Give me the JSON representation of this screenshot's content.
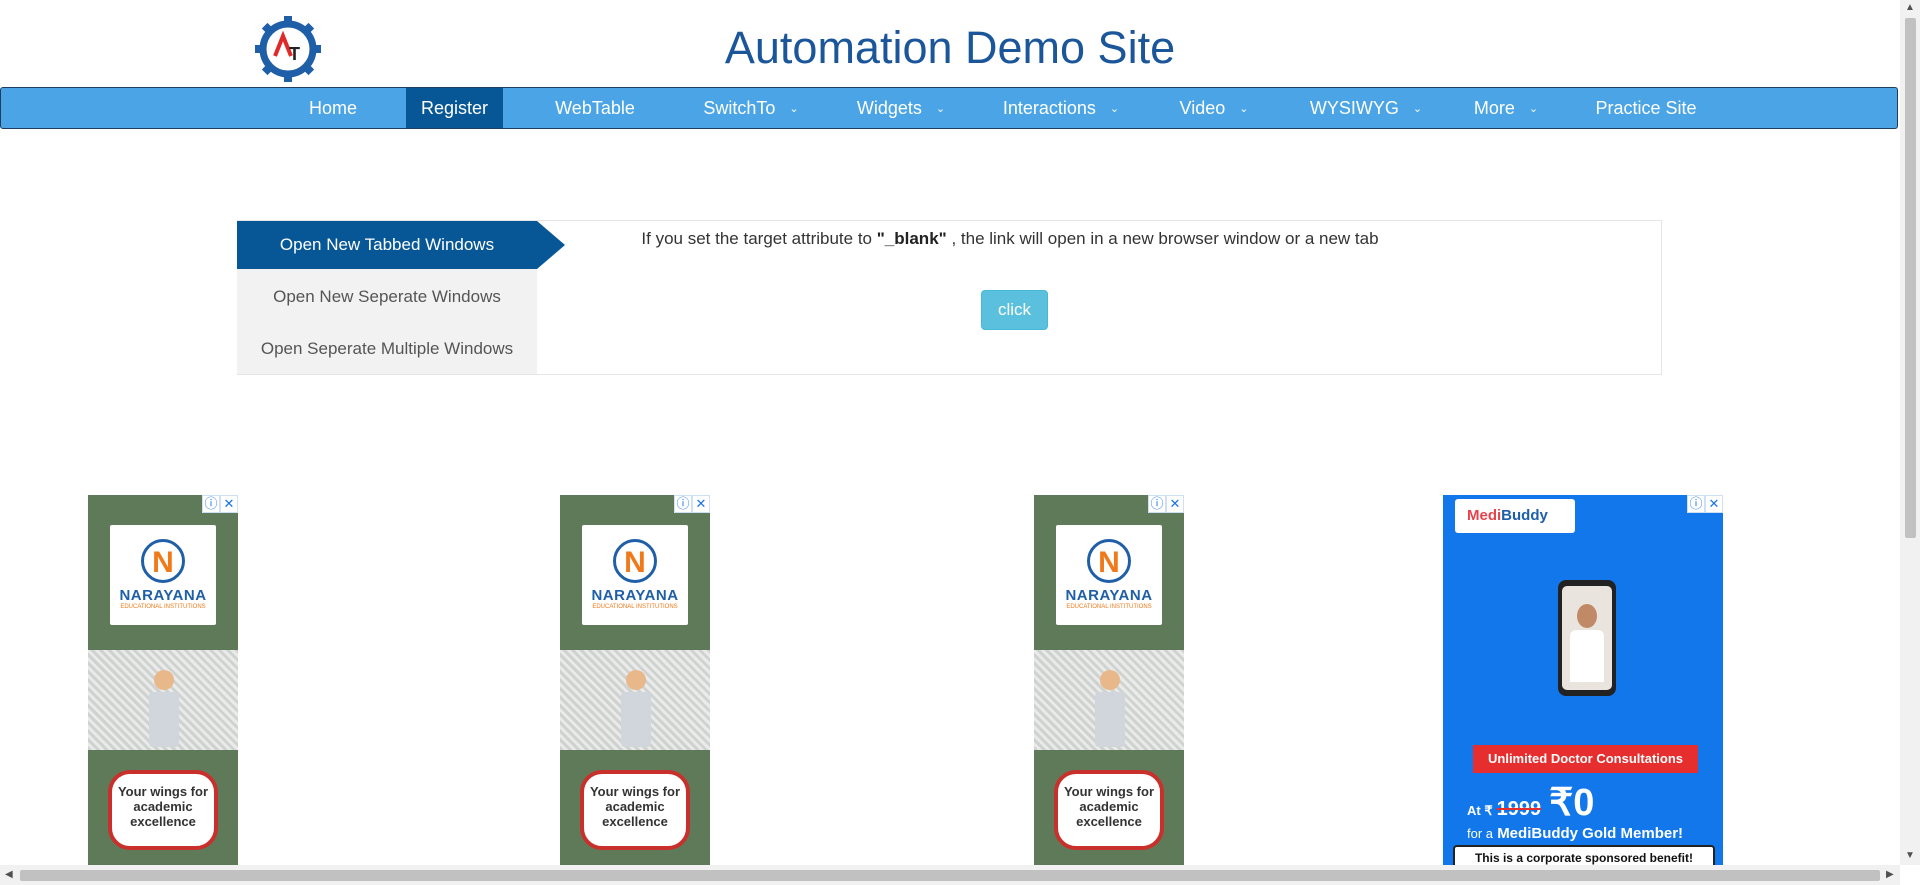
{
  "header": {
    "title": "Automation Demo Site",
    "logo_letters": "AT"
  },
  "nav": {
    "items": [
      {
        "label": "Home",
        "has_dropdown": false,
        "active": false
      },
      {
        "label": "Register",
        "has_dropdown": false,
        "active": true
      },
      {
        "label": "WebTable",
        "has_dropdown": false,
        "active": false
      },
      {
        "label": "SwitchTo",
        "has_dropdown": true,
        "active": false
      },
      {
        "label": "Widgets",
        "has_dropdown": true,
        "active": false
      },
      {
        "label": "Interactions",
        "has_dropdown": true,
        "active": false
      },
      {
        "label": "Video",
        "has_dropdown": true,
        "active": false
      },
      {
        "label": "WYSIWYG",
        "has_dropdown": true,
        "active": false
      },
      {
        "label": "More",
        "has_dropdown": true,
        "active": false
      },
      {
        "label": "Practice Site",
        "has_dropdown": false,
        "active": false
      }
    ],
    "chevron_glyph": "⌄"
  },
  "windows": {
    "tabs": [
      {
        "label": "Open New Tabbed Windows",
        "active": true
      },
      {
        "label": "Open New Seperate Windows",
        "active": false
      },
      {
        "label": "Open Seperate Multiple Windows",
        "active": false
      }
    ],
    "description_pre": "If you set the target attribute to ",
    "description_code": "\"_blank\"",
    "description_post": " , the link will open in a new browser window or a new tab",
    "button_label": "click"
  },
  "ads": {
    "close_info": "ⓘ",
    "close_x": "✕",
    "narayana": {
      "logo_letter": "N",
      "name": "NARAYANA",
      "sub": "EDUCATIONAL INSTITUTIONS",
      "bubble": "Your wings for academic excellence"
    },
    "medibuddy": {
      "logo_medi": "Medi",
      "logo_buddy": "Buddy",
      "ribbon": "Unlimited Doctor Consultations",
      "price_at": "At ₹",
      "price_old": "1999",
      "price_new": "₹0",
      "member_pre": "for a",
      "member": "MediBuddy Gold Member!",
      "sponsored": "This is a corporate sponsored benefit!"
    }
  },
  "colors": {
    "title": "#1a5699",
    "nav_bg": "#4aa4e5",
    "nav_active": "#075797",
    "button": "#5bc0de"
  }
}
